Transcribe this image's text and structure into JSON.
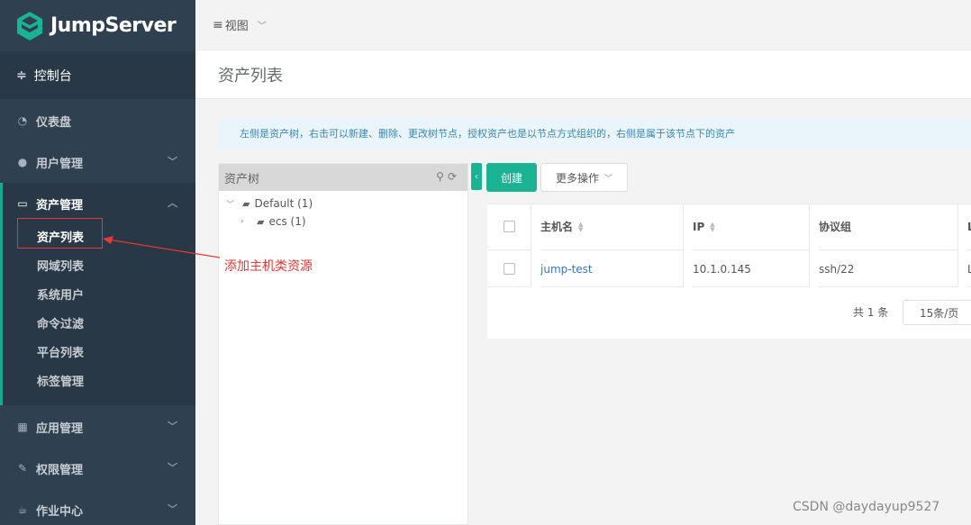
{
  "app": {
    "brand": "JumpServer",
    "console": "控制台"
  },
  "sidebar": {
    "items": [
      {
        "label": "仪表盘",
        "icon": "dashboard-icon"
      },
      {
        "label": "用户管理",
        "icon": "users-icon"
      },
      {
        "label": "资产管理",
        "icon": "inbox-icon"
      },
      {
        "label": "应用管理",
        "icon": "grid-icon"
      },
      {
        "label": "权限管理",
        "icon": "edit-icon"
      },
      {
        "label": "作业中心",
        "icon": "coffee-icon"
      }
    ],
    "asset_submenu": [
      "资产列表",
      "网域列表",
      "系统用户",
      "命令过滤",
      "平台列表",
      "标签管理"
    ]
  },
  "topbar": {
    "view_label": "视图"
  },
  "page": {
    "title": "资产列表",
    "info": "左侧是资产树，右击可以新建、删除、更改树节点，授权资产也是以节点方式组织的，右侧是属于该节点下的资产"
  },
  "tree": {
    "title": "资产树",
    "root": "Default (1)",
    "child": "ecs (1)"
  },
  "toolbar": {
    "create": "创建",
    "more": "更多操作"
  },
  "table": {
    "headers": [
      "主机名",
      "IP",
      "协议组",
      "L"
    ],
    "rows": [
      {
        "hostname": "jump-test",
        "ip": "10.1.0.145",
        "protocols": "ssh/22",
        "extra": "L"
      }
    ]
  },
  "pager": {
    "total": "共 1 条",
    "page_size": "15条/页"
  },
  "annotation": "添加主机类资源",
  "watermark": "CSDN @daydayup9527",
  "colors": {
    "sidebar": "#2f4050",
    "accent": "#1ab394",
    "annotation": "#e53935"
  }
}
